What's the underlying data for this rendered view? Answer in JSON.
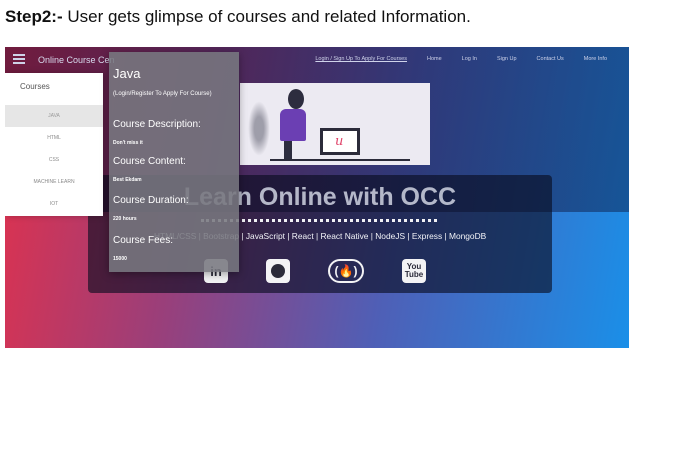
{
  "caption": {
    "step": "Step2:-",
    "text": " User gets glimpse of courses and related Information."
  },
  "navbar": {
    "brand": "Online Course Cen",
    "links": [
      "Login / Sign Up To Apply For Courses",
      "Home",
      "Log In",
      "Sign Up",
      "Contact Us",
      "More Info"
    ]
  },
  "hero": {
    "title": "Learn Online with OCC",
    "tech_stack": "HTML/CSS | Bootstrap | JavaScript | React | React Native | NodeJS | Express | MongoDB",
    "icons": [
      "linkedin-icon",
      "github-icon",
      "freecodecamp-icon",
      "youtube-icon"
    ],
    "youtube_top": "You",
    "youtube_bottom": "Tube",
    "linkedin_text": "in",
    "fcc_text": "(🔥)",
    "illustration_letter": "u"
  },
  "courses_panel": {
    "heading": "Courses",
    "items": [
      "JAVA",
      "HTML",
      "CSS",
      "MACHINE LEARN",
      "IOT"
    ],
    "active_index": 0
  },
  "course_detail": {
    "name": "Java",
    "subtitle": "(Login/Register To Apply For Course)",
    "description_label": "Course Description:",
    "description_value": "Don't miss it",
    "content_label": "Course Content:",
    "content_value": "Best Ekdam",
    "duration_label": "Course Duration:",
    "duration_value": "220 hours",
    "fees_label": "Course Fees:",
    "fees_value": "15000"
  },
  "colors": {
    "gradient_left": "#e2314c",
    "gradient_right": "#1a8fe8",
    "detail_bg": "#78787f"
  }
}
